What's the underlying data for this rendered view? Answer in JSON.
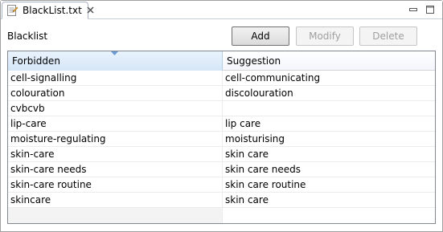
{
  "tab": {
    "title": "BlackList.txt",
    "close_glyph": "⌧",
    "icon": "text-file-icon"
  },
  "window": {
    "minimize_icon": "minimize-icon",
    "maximize_icon": "maximize-icon"
  },
  "section": {
    "label": "Blacklist"
  },
  "buttons": {
    "add": "Add",
    "modify": "Modify",
    "delete": "Delete"
  },
  "table": {
    "columns": [
      "Forbidden",
      "Suggestion"
    ],
    "rows": [
      {
        "forbidden": "cell-signalling",
        "suggestion": "cell-communicating"
      },
      {
        "forbidden": "colouration",
        "suggestion": "discolouration"
      },
      {
        "forbidden": "cvbcvb",
        "suggestion": ""
      },
      {
        "forbidden": "lip-care",
        "suggestion": "lip care"
      },
      {
        "forbidden": "moisture-regulating",
        "suggestion": "moisturising"
      },
      {
        "forbidden": "skin-care",
        "suggestion": "skin care"
      },
      {
        "forbidden": "skin-care needs",
        "suggestion": "skin care needs"
      },
      {
        "forbidden": "skin-care routine",
        "suggestion": "skin care routine"
      },
      {
        "forbidden": "skincare",
        "suggestion": "skin care"
      }
    ]
  },
  "colors": {
    "sorted_header": "#d5e6f7",
    "sort_arrow": "#6a9cd3",
    "table_border": "#828790"
  }
}
